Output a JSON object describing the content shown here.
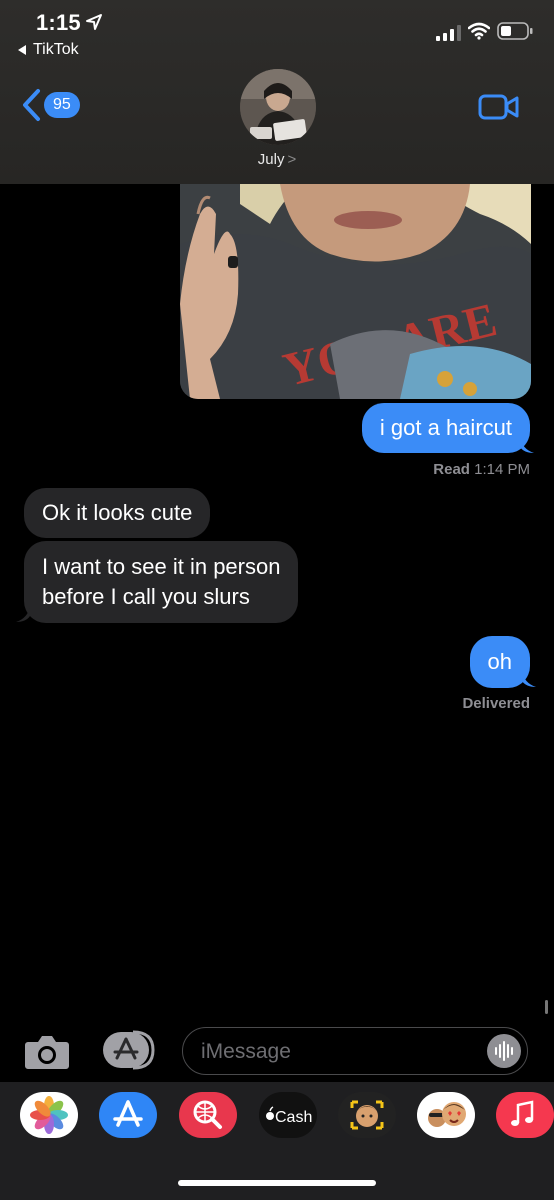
{
  "status_bar": {
    "time": "1:15",
    "back_app": "TikTok"
  },
  "nav": {
    "unread_count": "95",
    "contact_name": "July",
    "chevron": ">"
  },
  "messages": [
    {
      "type": "image",
      "direction": "outgoing"
    },
    {
      "type": "text",
      "direction": "outgoing",
      "text": "i got a haircut"
    },
    {
      "type": "text",
      "direction": "incoming",
      "text": "Ok it looks cute"
    },
    {
      "type": "text",
      "direction": "incoming",
      "text_lines": [
        "I want to see it in person",
        "before I call you slurs"
      ]
    },
    {
      "type": "text",
      "direction": "outgoing",
      "text": "oh"
    }
  ],
  "receipts": {
    "read_label": "Read",
    "read_time": "1:14 PM",
    "delivered": "Delivered"
  },
  "compose": {
    "placeholder": "iMessage"
  },
  "drawer": {
    "apps": [
      "photos-icon",
      "app-store-icon",
      "search-images-icon",
      "apple-cash-icon",
      "memoji-icon",
      "memoji-stickers-icon",
      "music-icon"
    ],
    "cash_label": "Cash"
  },
  "colors": {
    "outgoing_bubble": "#3b8cf7",
    "incoming_bubble": "#262628",
    "header_bg": "#2e2d2b"
  }
}
